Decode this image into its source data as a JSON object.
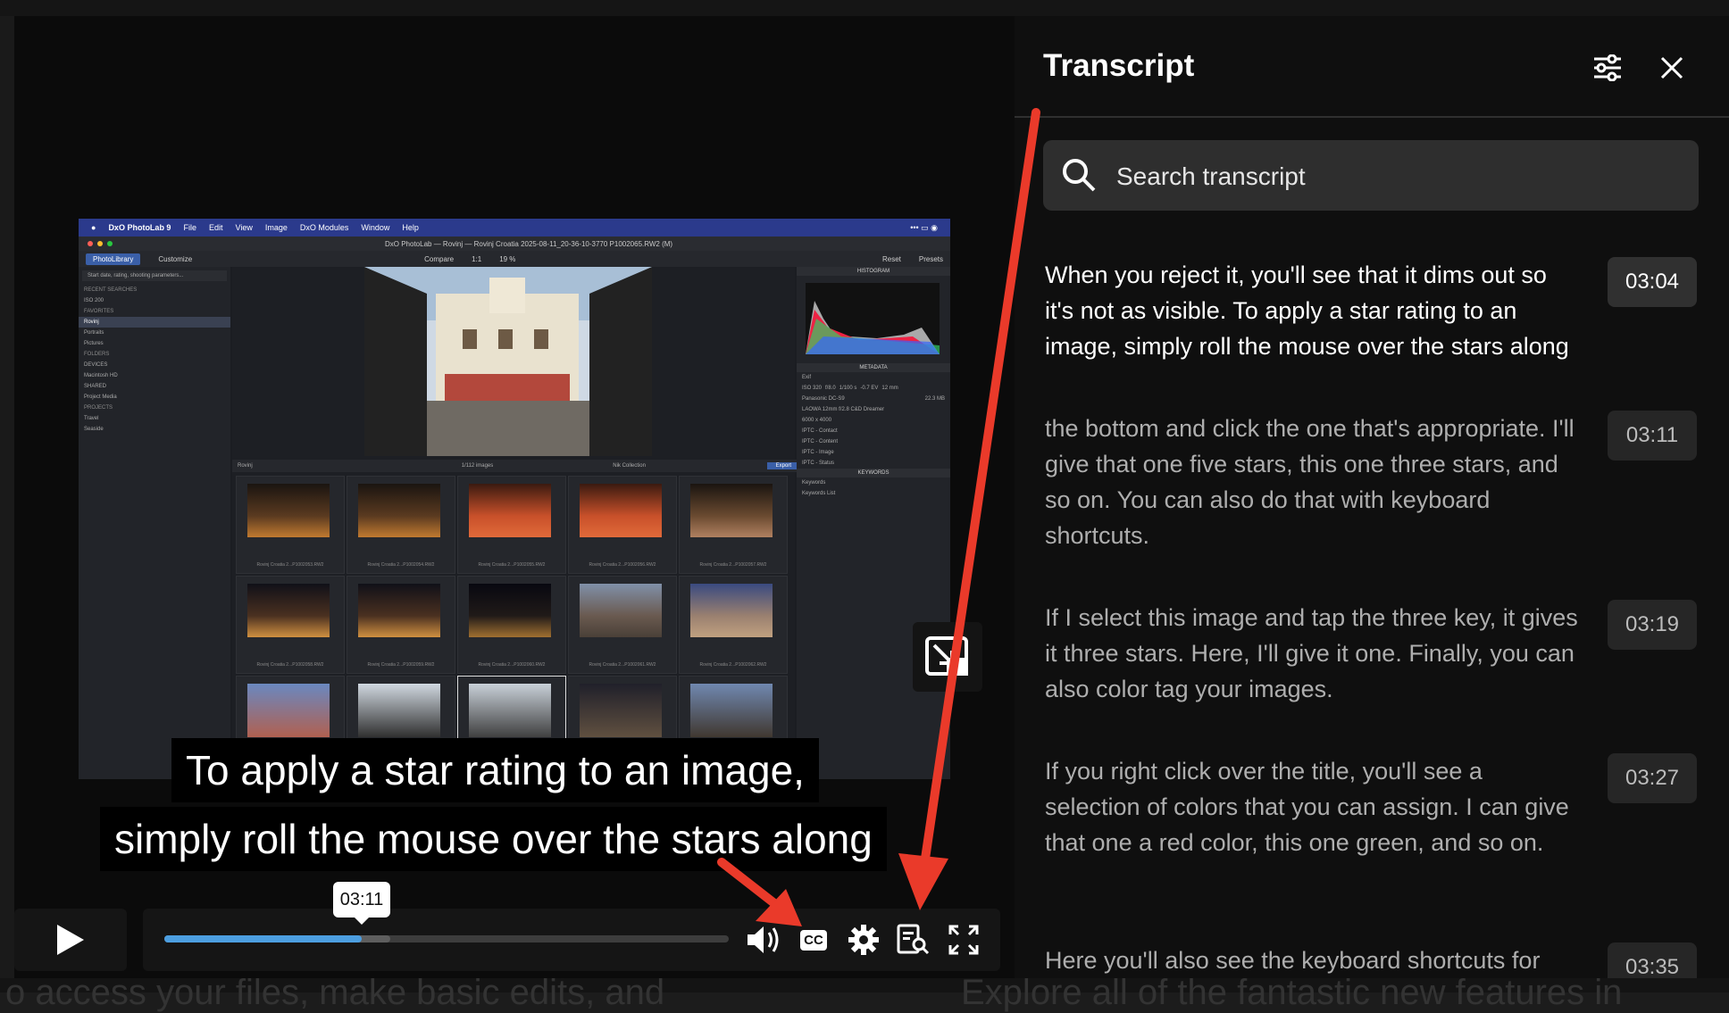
{
  "video": {
    "app": {
      "menubar": [
        "DxO PhotoLab 9",
        "File",
        "Edit",
        "View",
        "Image",
        "DxO Modules",
        "Window",
        "Help"
      ],
      "window_title": "DxO PhotoLab — Rovinj — Rovinj Croatia 2025-08-11_20-36-10-3770 P1002065.RW2 (M)",
      "tabs": [
        "PhotoLibrary",
        "Customize"
      ],
      "toolbar": [
        "Compare",
        "1:1",
        "19 %",
        "Reset",
        "Presets"
      ],
      "left_panel": [
        "Start date, rating, shooting parameters...",
        "RECENT SEARCHES",
        "ISO 200",
        "FAVORITES",
        "Rovinj",
        "Portraits",
        "Pictures",
        "FOLDERS",
        "DEVICES",
        "Macintosh HD",
        "SHARED",
        "Project Media",
        "PROJECTS",
        "Travel",
        "Seaside"
      ],
      "filmbar": {
        "folder": "Rovinj",
        "count": "1/112 images",
        "nik": "Nik Collection",
        "export": "Export"
      },
      "thumbs": [
        "Rovinj Croatia 2...P1002053.RW2",
        "Rovinj Croatia 2...P1002054.RW2",
        "Rovinj Croatia 2...P1002055.RW2",
        "Rovinj Croatia 2...P1002056.RW2",
        "Rovinj Croatia 2...P1002057.RW2",
        "Rovinj Croatia 2...P1002058.RW2",
        "Rovinj Croatia 2...P1002059.RW2",
        "Rovinj Croatia 2...P1002060.RW2",
        "Rovinj Croatia 2...P1002061.RW2",
        "Rovinj Croatia 2...P1002062.RW2"
      ],
      "right_panel": {
        "histogram": "HISTOGRAM",
        "metadata": "METADATA",
        "exif": "Exif",
        "exif_values": [
          "ISO 320",
          "f/8.0",
          "1/100 s",
          "-0.7 EV",
          "12 mm"
        ],
        "camera": "Panasonic DC-S9",
        "lens": "LAOWA 12mm f/2.8 C&D Dreamer",
        "size": "22.3 MB",
        "dims": "6000 x 4000",
        "iptc": [
          "IPTC - Contact",
          "IPTC - Content",
          "IPTC - Image",
          "IPTC - Status"
        ],
        "keywords": "KEYWORDS",
        "kw_items": [
          "Keywords",
          "Keywords List"
        ]
      }
    },
    "subtitle_line1": "To apply a star rating to an image,",
    "subtitle_line2": "simply roll the mouse over the stars along"
  },
  "player": {
    "current_time_tooltip": "03:11",
    "progress": 0.35,
    "buffered": 0.4,
    "cc_label": "CC"
  },
  "transcript": {
    "title": "Transcript",
    "search_placeholder": "Search transcript",
    "entries": [
      {
        "text": "When you reject it, you'll see that it dims out so it's not as visible. To apply a star rating to an image, simply roll the mouse over the stars along",
        "time": "03:04",
        "active": true
      },
      {
        "text": "the bottom and click the one that's appropriate. I'll give that one five stars, this one three stars, and so on. You can also do that with keyboard shortcuts.",
        "time": "03:11",
        "active": false
      },
      {
        "text": "If I select this image and tap the three key, it gives it three stars. Here, I'll give it one. Finally, you can also color tag your images.",
        "time": "03:19",
        "active": false
      },
      {
        "text": "If you right click over the title, you'll see a selection of colors that you can assign. I can give that one a red color, this one green, and so on.",
        "time": "03:27",
        "active": false
      },
      {
        "text": "Here you'll also see the keyboard shortcuts for",
        "time": "03:35",
        "active": false
      }
    ]
  },
  "background_text": [
    "o access your files, make basic edits, and",
    "Explore all of the fantastic new features in"
  ],
  "colors": {
    "accent": "#4c9ee0",
    "arrow": "#ea3a2a",
    "panel": "#0f0f0f"
  }
}
